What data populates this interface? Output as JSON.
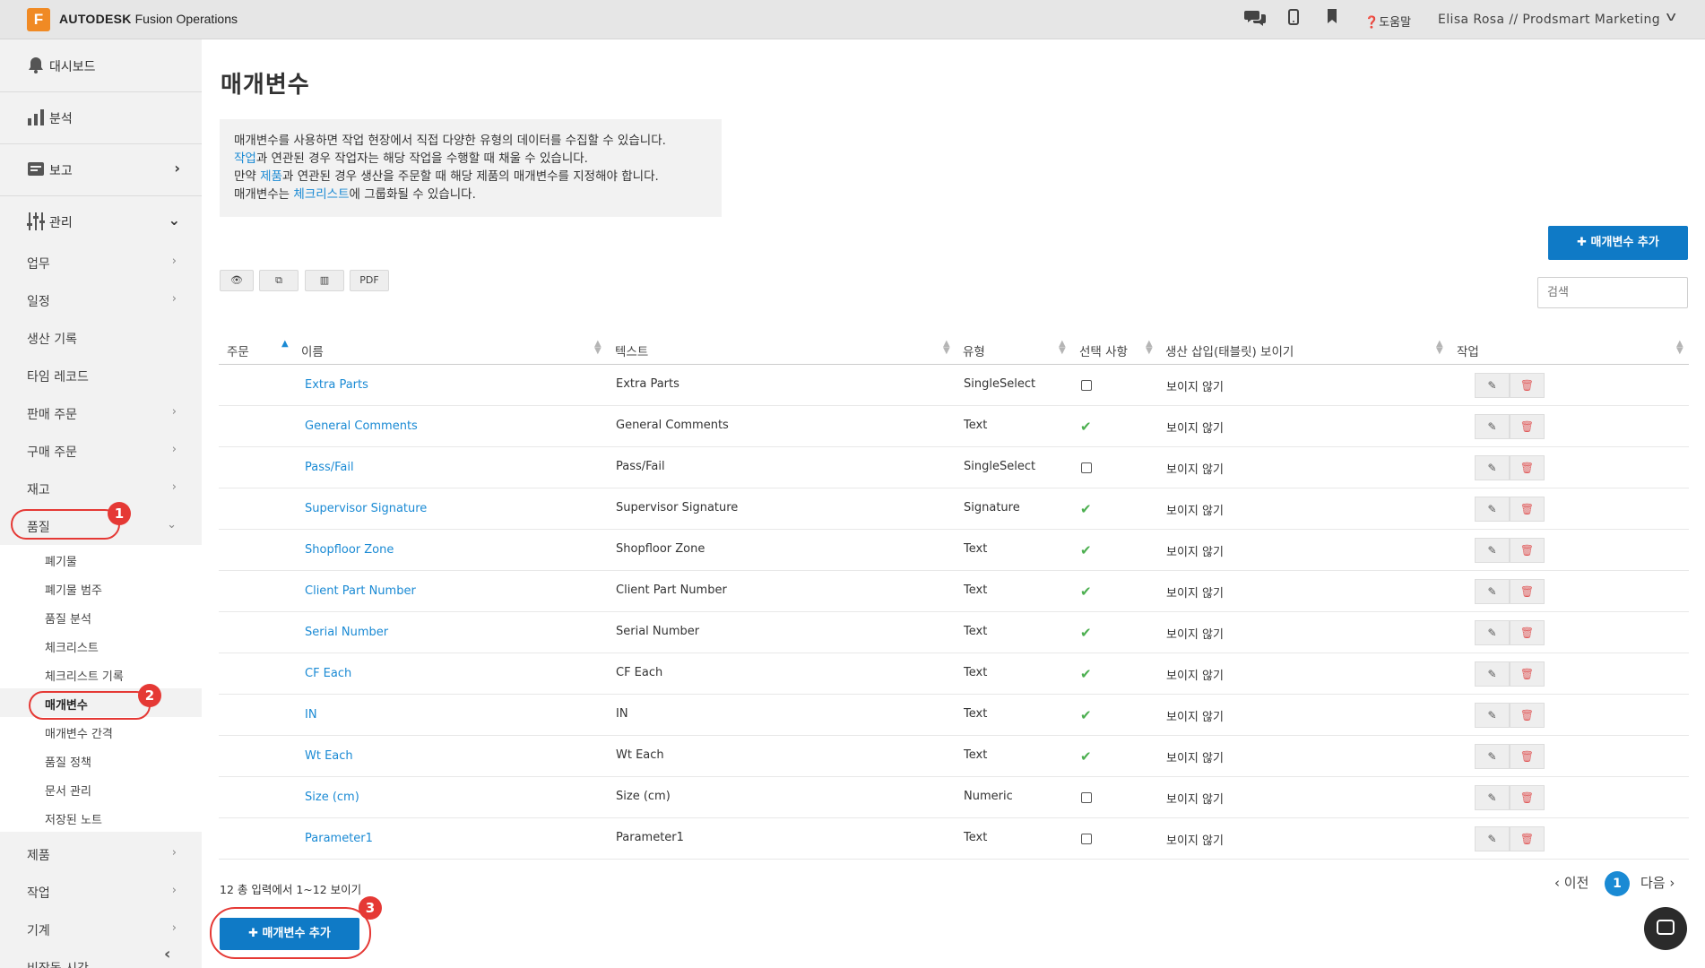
{
  "app": {
    "logo_letter": "F",
    "brand_bold": "AUTODESK",
    "brand_rest": "Fusion Operations",
    "help_label": "도움말",
    "user_label": "Elisa Rosa // Prodsmart Marketing"
  },
  "sidebar": {
    "main": [
      {
        "label": "대시보드",
        "icon": "bell-icon"
      },
      {
        "label": "분석",
        "icon": "bar-chart-icon"
      },
      {
        "label": "보고",
        "icon": "report-icon"
      },
      {
        "label": "관리",
        "icon": "sliders-icon"
      }
    ],
    "items": [
      {
        "label": "업무"
      },
      {
        "label": "일정"
      },
      {
        "label": "생산 기록"
      },
      {
        "label": "타임 레코드"
      },
      {
        "label": "판매 주문"
      },
      {
        "label": "구매 주문"
      },
      {
        "label": "재고"
      },
      {
        "label": "품질"
      }
    ],
    "sub_items": [
      {
        "label": "폐기물"
      },
      {
        "label": "폐기물 범주"
      },
      {
        "label": "품질 분석"
      },
      {
        "label": "체크리스트"
      },
      {
        "label": "체크리스트 기록"
      },
      {
        "label": "매개변수"
      },
      {
        "label": "매개변수 간격"
      },
      {
        "label": "품질 정책"
      },
      {
        "label": "문서 관리"
      },
      {
        "label": "저장된 노트"
      }
    ],
    "bottom_items": [
      {
        "label": "제품"
      },
      {
        "label": "작업"
      },
      {
        "label": "기계"
      },
      {
        "label": "비작동 시간"
      }
    ]
  },
  "annotations": [
    "1",
    "2",
    "3"
  ],
  "main": {
    "title": "매개변수",
    "info": {
      "line1": "매개변수를 사용하면 작업 현장에서 직접 다양한 유형의 데이터를 수집할 수 있습니다.",
      "line2_link": "작업",
      "line2_rest": "과 연관된 경우 작업자는 해당 작업을 수행할 때 채울 수 있습니다.",
      "line3_pre": "만약 ",
      "line3_link": "제품",
      "line3_rest": "과 연관된 경우 생산을 주문할 때 해당 제품의 매개변수를 지정해야 합니다.",
      "line4_pre": "매개변수는 ",
      "line4_link": "체크리스트",
      "line4_rest": "에 그룹화될 수 있습니다."
    },
    "add_button_label": "✚ 매개변수 추가",
    "tools": {
      "pdf": "PDF"
    },
    "search_placeholder": "검색",
    "columns": {
      "order": "주문",
      "name": "이름",
      "text": "텍스트",
      "type": "유형",
      "optional": "선택 사항",
      "visible": "생산 삽입(태블릿) 보이기",
      "actions": "작업"
    },
    "rows": [
      {
        "name": "Extra Parts",
        "text": "Extra Parts",
        "type": "SingleSelect",
        "optional": false,
        "visible": "보이지 않기"
      },
      {
        "name": "General Comments",
        "text": "General Comments",
        "type": "Text",
        "optional": true,
        "visible": "보이지 않기"
      },
      {
        "name": "Pass/Fail",
        "text": "Pass/Fail",
        "type": "SingleSelect",
        "optional": false,
        "visible": "보이지 않기"
      },
      {
        "name": "Supervisor Signature",
        "text": "Supervisor Signature",
        "type": "Signature",
        "optional": true,
        "visible": "보이지 않기"
      },
      {
        "name": "Shopfloor Zone",
        "text": "Shopfloor Zone",
        "type": "Text",
        "optional": true,
        "visible": "보이지 않기"
      },
      {
        "name": "Client Part Number",
        "text": "Client Part Number",
        "type": "Text",
        "optional": true,
        "visible": "보이지 않기"
      },
      {
        "name": "Serial Number",
        "text": "Serial Number",
        "type": "Text",
        "optional": true,
        "visible": "보이지 않기"
      },
      {
        "name": "CF Each",
        "text": "CF Each",
        "type": "Text",
        "optional": true,
        "visible": "보이지 않기"
      },
      {
        "name": "IN",
        "text": "IN",
        "type": "Text",
        "optional": true,
        "visible": "보이지 않기"
      },
      {
        "name": "Wt Each",
        "text": "Wt Each",
        "type": "Text",
        "optional": true,
        "visible": "보이지 않기"
      },
      {
        "name": "Size (cm)",
        "text": "Size (cm)",
        "type": "Numeric",
        "optional": false,
        "visible": "보이지 않기"
      },
      {
        "name": "Parameter1",
        "text": "Parameter1",
        "type": "Text",
        "optional": false,
        "visible": "보이지 않기"
      }
    ],
    "count_text": "12 총 입력에서 1~12 보이기",
    "pager": {
      "prev": "‹ 이전",
      "page": "1",
      "next": "다음 ›"
    }
  },
  "colors": {
    "accent": "#0f7ac6",
    "link": "#1a8ad4",
    "annotation": "#e53935",
    "check": "#4caf50"
  }
}
